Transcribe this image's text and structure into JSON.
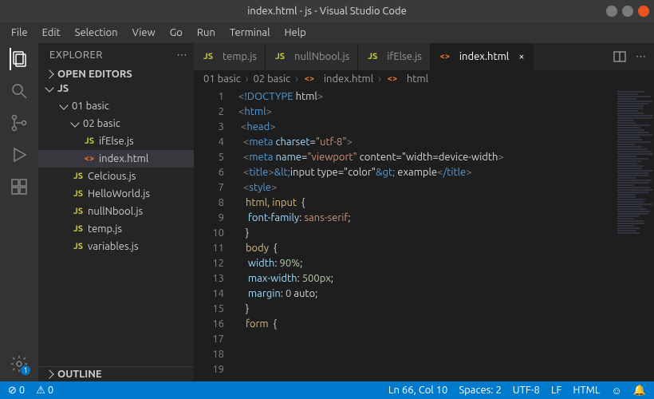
{
  "window": {
    "title": "index.html - js - Visual Studio Code"
  },
  "menu": {
    "items": [
      "File",
      "Edit",
      "Selection",
      "View",
      "Go",
      "Run",
      "Terminal",
      "Help"
    ]
  },
  "activity": {
    "settings_badge": "1"
  },
  "explorer": {
    "title": "EXPLORER",
    "open_editors_label": "OPEN EDITORS",
    "workspace_label": "JS",
    "outline_label": "OUTLINE",
    "tree": [
      {
        "label": "01 basic",
        "type": "folder",
        "depth": 1
      },
      {
        "label": "02 basic",
        "type": "folder",
        "depth": 2
      },
      {
        "label": "ifElse.js",
        "type": "js",
        "depth": 3
      },
      {
        "label": "index.html",
        "type": "html",
        "depth": 3,
        "selected": true
      },
      {
        "label": "Celcious.js",
        "type": "js",
        "depth": 2
      },
      {
        "label": "HelloWorld.js",
        "type": "js",
        "depth": 2
      },
      {
        "label": "nullNbool.js",
        "type": "js",
        "depth": 2
      },
      {
        "label": "temp.js",
        "type": "js",
        "depth": 2
      },
      {
        "label": "variables.js",
        "type": "js",
        "depth": 2
      }
    ]
  },
  "tabs": [
    {
      "label": "temp.js",
      "icon": "js"
    },
    {
      "label": "nullNbool.js",
      "icon": "js"
    },
    {
      "label": "ifElse.js",
      "icon": "js"
    },
    {
      "label": "index.html",
      "icon": "html",
      "active": true
    }
  ],
  "breadcrumbs": {
    "parts": [
      "01 basic",
      "02 basic",
      "index.html",
      "html"
    ],
    "icons": [
      "",
      "",
      "html",
      "code"
    ]
  },
  "code": {
    "first_line": 1,
    "lines": [
      "",
      "<!DOCTYPE html>",
      "<html>",
      " <head>",
      "  <meta charset=\"utf-8\">",
      "  <meta name=\"viewport\" content=\"width=device-width\"",
      "  <title>&lt;input type=\"color\"&gt; example</title>",
      "  <style>",
      "   html, input {",
      "    font-family: sans-serif;",
      "   }",
      "",
      "   body {",
      "    width: 90%;",
      "    max-width: 500px;",
      "    margin: 0 auto;",
      "   }",
      "",
      "   form {"
    ]
  },
  "status": {
    "errors": "0",
    "warnings": "0",
    "position": "Ln 66, Col 10",
    "spaces": "Spaces: 2",
    "encoding": "UTF-8",
    "eol": "LF",
    "language": "HTML"
  }
}
